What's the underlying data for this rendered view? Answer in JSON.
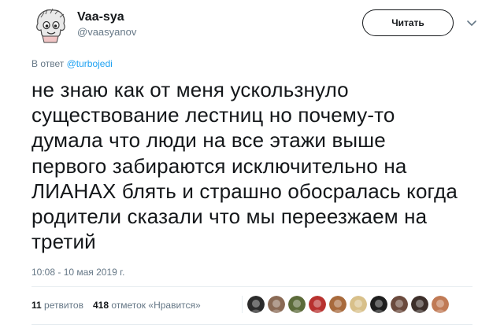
{
  "user": {
    "display_name": "Vaa-sya",
    "handle": "@vaasyanov"
  },
  "follow_label": "Читать",
  "reply": {
    "prefix": "В ответ ",
    "to": "@turbojedi"
  },
  "tweet_text": "не знаю как от меня ускользнуло\nсуществование лестниц но почему-то\nдумала что люди на все этажи выше\nпервого забираются исключительно на\nЛИАНАХ блять и страшно обосралась когда\nродители сказали что мы переезжаем на\nтретий",
  "timestamp": "10:08 - 10 мая 2019 г.",
  "stats": {
    "retweets_count": "11",
    "retweets_label": "ретвитов",
    "likes_count": "418",
    "likes_label": "отметок «Нравится»"
  },
  "likers": [
    {
      "icon": "avatar-dark-circle",
      "color": "#2b2b2b"
    },
    {
      "icon": "avatar-face",
      "color": "#8a6a55"
    },
    {
      "icon": "avatar-art",
      "color": "#5c6b3a"
    },
    {
      "icon": "avatar-red",
      "color": "#b8322f"
    },
    {
      "icon": "avatar-colorful",
      "color": "#a86a3c"
    },
    {
      "icon": "avatar-blonde",
      "color": "#d8c08a"
    },
    {
      "icon": "avatar-logo",
      "color": "#1e1e1e"
    },
    {
      "icon": "avatar-portrait",
      "color": "#6b4a3d"
    },
    {
      "icon": "avatar-dark-hair",
      "color": "#3d2f2a"
    },
    {
      "icon": "avatar-last",
      "color": "#c07a55"
    }
  ],
  "colors": {
    "text": "#14171a",
    "secondary": "#657786",
    "link": "#1da1f2",
    "divider": "#e6ecf0"
  }
}
